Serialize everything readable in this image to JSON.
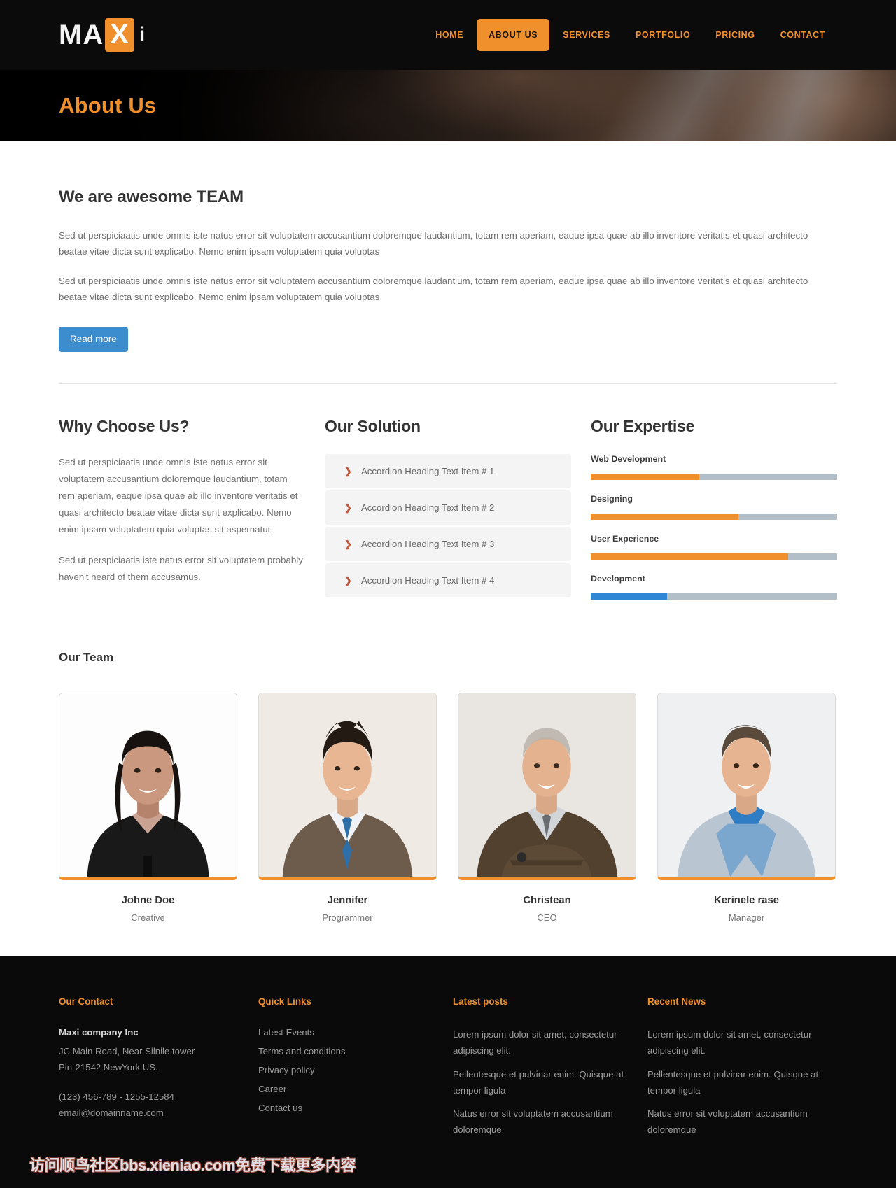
{
  "brand": {
    "text_a": "MA",
    "box": "X",
    "text_b": "i",
    "accent": "#f0902c"
  },
  "nav": {
    "items": [
      {
        "label": "HOME",
        "active": false
      },
      {
        "label": "ABOUT US",
        "active": true
      },
      {
        "label": "SERVICES",
        "active": false
      },
      {
        "label": "PORTFOLIO",
        "active": false
      },
      {
        "label": "PRICING",
        "active": false
      },
      {
        "label": "CONTACT",
        "active": false
      }
    ]
  },
  "hero": {
    "title": "About Us"
  },
  "intro": {
    "heading": "We are awesome TEAM",
    "paragraph1": "Sed ut perspiciaatis unde omnis iste natus error sit voluptatem accusantium doloremque laudantium, totam rem aperiam, eaque ipsa quae ab illo inventore veritatis et quasi architecto beatae vitae dicta sunt explicabo. Nemo enim ipsam voluptatem quia voluptas",
    "paragraph2": "Sed ut perspiciaatis unde omnis iste natus error sit voluptatem accusantium doloremque laudantium, totam rem aperiam, eaque ipsa quae ab illo inventore veritatis et quasi architecto beatae vitae dicta sunt explicabo. Nemo enim ipsam voluptatem quia voluptas",
    "read_more": "Read more",
    "button_color": "#3c8dcd"
  },
  "why": {
    "heading": "Why Choose Us?",
    "paragraph1": "Sed ut perspiciaatis unde omnis iste natus error sit voluptatem accusantium doloremque laudantium, totam rem aperiam, eaque ipsa quae ab illo inventore veritatis et quasi architecto beatae vitae dicta sunt explicabo. Nemo enim ipsam voluptatem quia voluptas sit aspernatur.",
    "paragraph2": "Sed ut perspiciaatis iste natus error sit voluptatem probably haven't heard of them accusamus."
  },
  "solution": {
    "heading": "Our Solution",
    "items": [
      {
        "label": "Accordion Heading Text Item # 1",
        "icon": "chevron-right-icon"
      },
      {
        "label": "Accordion Heading Text Item # 2",
        "icon": "chevron-right-icon"
      },
      {
        "label": "Accordion Heading Text Item # 3",
        "icon": "chevron-right-icon"
      },
      {
        "label": "Accordion Heading Text Item # 4",
        "icon": "chevron-right-icon"
      }
    ]
  },
  "expertise": {
    "heading": "Our Expertise",
    "skills": [
      {
        "name": "Web Development",
        "percent": 44,
        "color": "#f0902c"
      },
      {
        "name": "Designing",
        "percent": 60,
        "color": "#f0902c"
      },
      {
        "name": "User Experience",
        "percent": 80,
        "color": "#f0902c"
      },
      {
        "name": "Development",
        "percent": 31,
        "color": "#2e86d4"
      }
    ]
  },
  "team": {
    "heading": "Our Team",
    "members": [
      {
        "name": "Johne Doe",
        "role": "Creative"
      },
      {
        "name": "Jennifer",
        "role": "Programmer"
      },
      {
        "name": "Christean",
        "role": "CEO"
      },
      {
        "name": "Kerinele rase",
        "role": "Manager"
      }
    ]
  },
  "footer": {
    "contact": {
      "heading": "Our Contact",
      "company": "Maxi company Inc",
      "address1": "JC Main Road, Near Silnile tower",
      "address2": "Pin-21542 NewYork US.",
      "phone": "(123) 456-789 - 1255-12584",
      "email": "email@domainname.com"
    },
    "quick_links": {
      "heading": "Quick Links",
      "items": [
        "Latest Events",
        "Terms and conditions",
        "Privacy policy",
        "Career",
        "Contact us"
      ]
    },
    "latest_posts": {
      "heading": "Latest posts",
      "items": [
        "Lorem ipsum dolor sit amet, consectetur adipiscing elit.",
        "Pellentesque et pulvinar enim. Quisque at tempor ligula",
        "Natus error sit voluptatem accusantium doloremque"
      ]
    },
    "recent_news": {
      "heading": "Recent News",
      "items": [
        "Lorem ipsum dolor sit amet, consectetur adipiscing elit.",
        "Pellentesque et pulvinar enim. Quisque at tempor ligula",
        "Natus error sit voluptatem accusantium doloremque"
      ]
    }
  },
  "watermark": "访问顺鸟社区bbs.xieniao.com免费下载更多内容"
}
